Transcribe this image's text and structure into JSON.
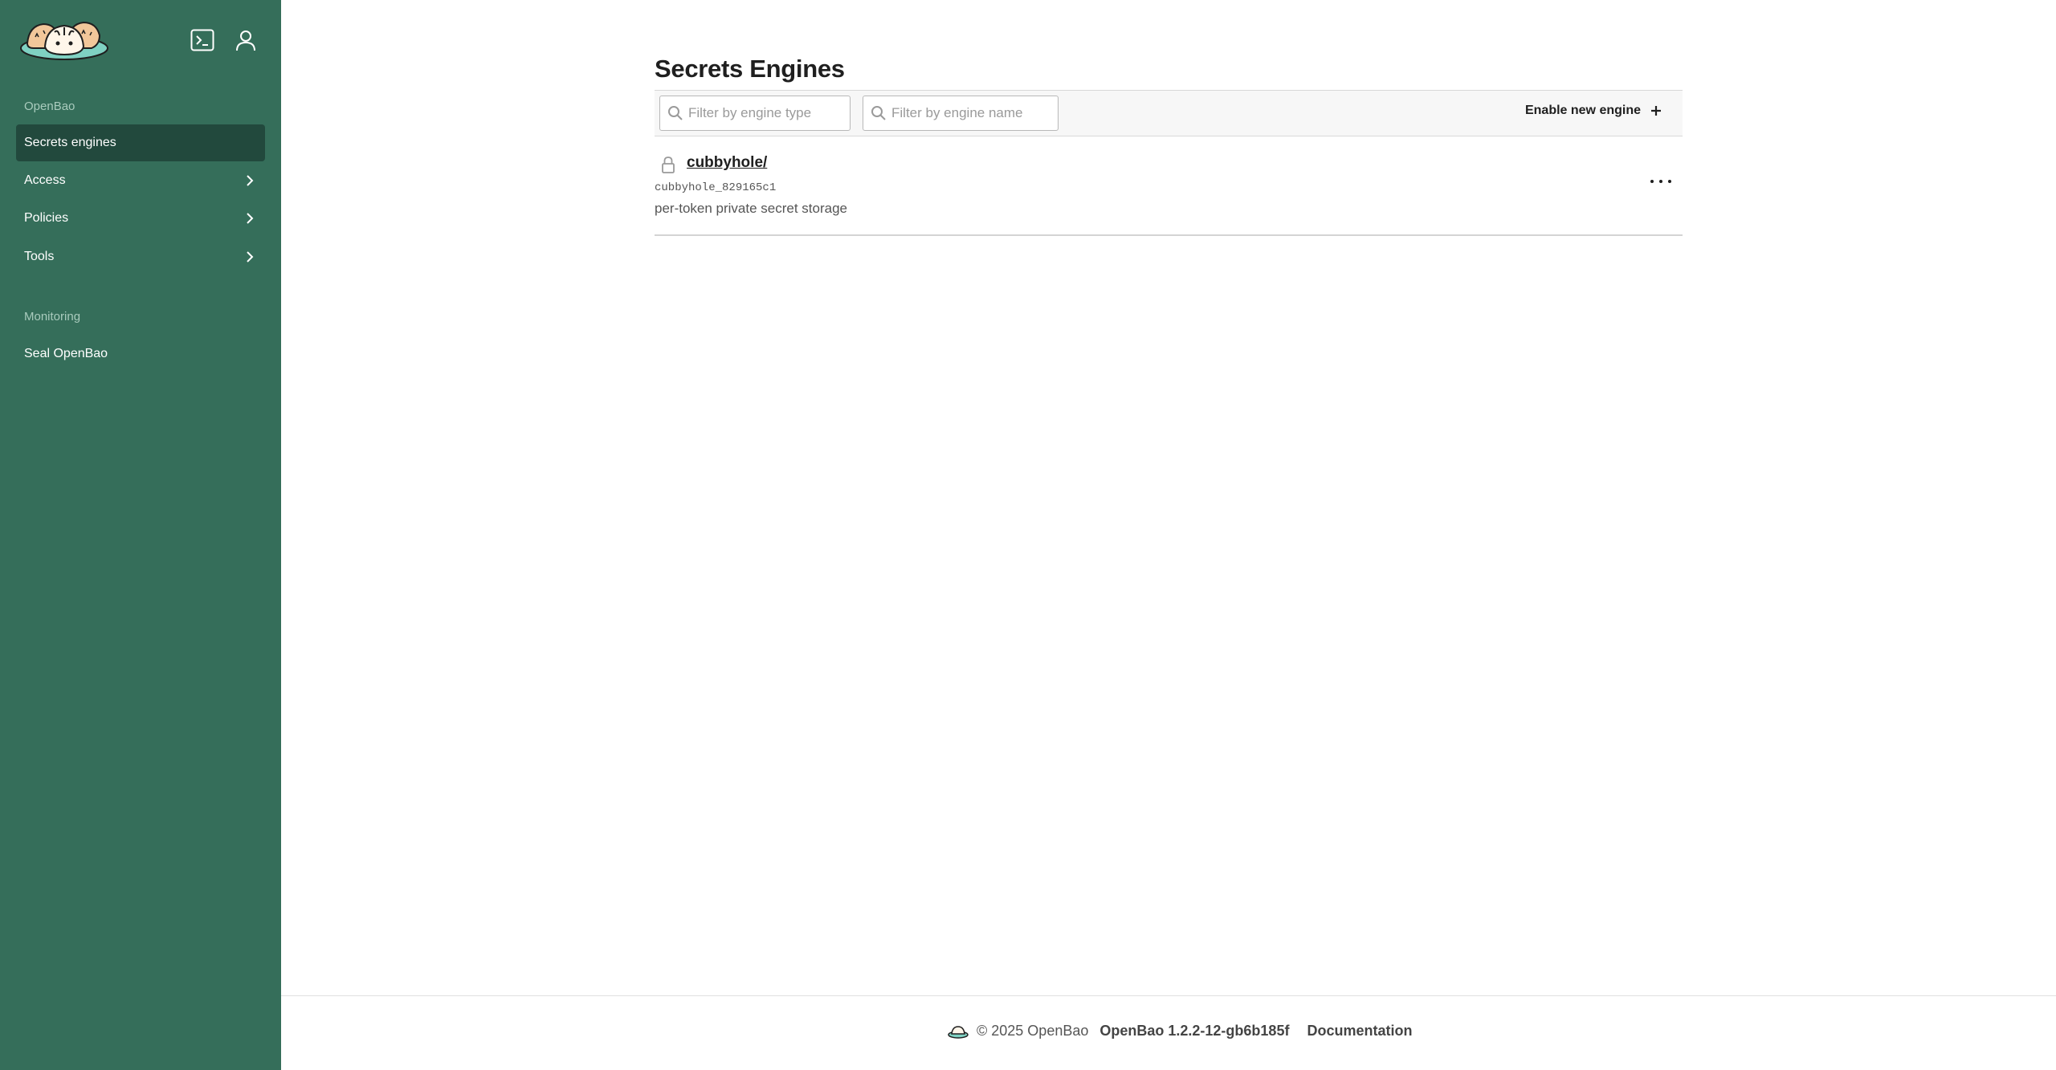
{
  "sidebar": {
    "section_openbao": "OpenBao",
    "items": [
      {
        "label": "Secrets engines",
        "active": true
      },
      {
        "label": "Access"
      },
      {
        "label": "Policies"
      },
      {
        "label": "Tools"
      }
    ],
    "section_monitoring": "Monitoring",
    "seal_label": "Seal OpenBao",
    "icons": [
      "openbao-logo",
      "terminal-icon",
      "user-icon",
      "chevron-right-icon"
    ]
  },
  "main": {
    "title": "Secrets Engines",
    "filter_type_placeholder": "Filter by engine type",
    "filter_name_placeholder": "Filter by engine name",
    "enable_label": "Enable new engine",
    "engines": [
      {
        "name": "cubbyhole/",
        "id": "cubbyhole_829165c1",
        "description": "per-token private secret storage",
        "icon": "lock-icon"
      }
    ]
  },
  "footer": {
    "copyright": "© 2025 OpenBao",
    "version": "OpenBao 1.2.2-12-gb6b185f",
    "docs": "Documentation"
  },
  "colors": {
    "sidebar_bg": "#356e5a",
    "sidebar_active": "#22493d",
    "section_label": "#a9cbbd"
  }
}
